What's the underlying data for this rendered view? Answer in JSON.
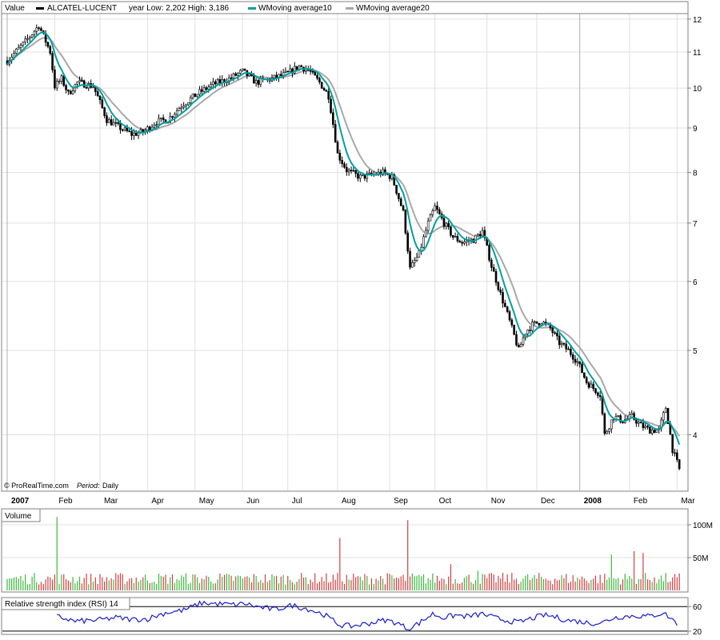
{
  "chart_data": [
    {
      "type": "candlestick",
      "title_label": "Value",
      "instrument": "ALCATEL-LUCENT",
      "year_range": "year Low: 2,202 High: 3,186",
      "legend": [
        {
          "name": "ALCATEL-LUCENT",
          "color": "#000000"
        },
        {
          "name": "WMoving average10",
          "color": "#00a0a0"
        },
        {
          "name": "WMoving average20",
          "color": "#a8a8a8"
        }
      ],
      "y_scale": "log",
      "ylim": [
        3.55,
        12.15
      ],
      "y_ticks": [
        4,
        5,
        6,
        7,
        8,
        9,
        10,
        11,
        12
      ],
      "x_ticks": [
        {
          "label": "2007",
          "bold": true,
          "day": 0
        },
        {
          "label": "Feb",
          "bold": false,
          "day": 21
        },
        {
          "label": "Mar",
          "bold": false,
          "day": 41
        },
        {
          "label": "Apr",
          "bold": false,
          "day": 62
        },
        {
          "label": "May",
          "bold": false,
          "day": 83
        },
        {
          "label": "Jun",
          "bold": false,
          "day": 104
        },
        {
          "label": "Jul",
          "bold": false,
          "day": 124
        },
        {
          "label": "Aug",
          "bold": false,
          "day": 146
        },
        {
          "label": "Sep",
          "bold": false,
          "day": 169
        },
        {
          "label": "Oct",
          "bold": false,
          "day": 189
        },
        {
          "label": "Nov",
          "bold": false,
          "day": 212
        },
        {
          "label": "Dec",
          "bold": false,
          "day": 234
        },
        {
          "label": "2008",
          "bold": true,
          "day": 253
        },
        {
          "label": "Feb",
          "bold": false,
          "day": 275
        },
        {
          "label": "Mar",
          "bold": false,
          "day": 296
        }
      ],
      "price_path": [
        [
          0,
          10.75
        ],
        [
          8,
          11.3
        ],
        [
          14,
          11.8
        ],
        [
          19,
          11.0
        ],
        [
          21,
          10.05
        ],
        [
          24,
          10.25
        ],
        [
          27,
          9.85
        ],
        [
          31,
          10.15
        ],
        [
          38,
          10.05
        ],
        [
          44,
          9.2
        ],
        [
          50,
          9.0
        ],
        [
          55,
          8.85
        ],
        [
          60,
          8.9
        ],
        [
          66,
          9.15
        ],
        [
          71,
          9.2
        ],
        [
          77,
          9.55
        ],
        [
          84,
          9.85
        ],
        [
          91,
          10.1
        ],
        [
          98,
          10.25
        ],
        [
          104,
          10.45
        ],
        [
          110,
          10.15
        ],
        [
          117,
          10.25
        ],
        [
          124,
          10.4
        ],
        [
          129,
          10.6
        ],
        [
          133,
          10.5
        ],
        [
          138,
          10.15
        ],
        [
          142,
          9.8
        ],
        [
          146,
          8.4
        ],
        [
          150,
          8.05
        ],
        [
          156,
          7.9
        ],
        [
          161,
          7.95
        ],
        [
          166,
          8.0
        ],
        [
          170,
          7.9
        ],
        [
          175,
          7.2
        ],
        [
          178,
          6.2
        ],
        [
          182,
          6.45
        ],
        [
          186,
          7.0
        ],
        [
          189,
          7.3
        ],
        [
          193,
          7.0
        ],
        [
          197,
          6.75
        ],
        [
          201,
          6.65
        ],
        [
          206,
          6.7
        ],
        [
          210,
          6.85
        ],
        [
          214,
          6.25
        ],
        [
          218,
          5.8
        ],
        [
          222,
          5.4
        ],
        [
          226,
          5.0
        ],
        [
          229,
          5.25
        ],
        [
          232,
          5.35
        ],
        [
          236,
          5.4
        ],
        [
          240,
          5.3
        ],
        [
          244,
          5.1
        ],
        [
          248,
          5.0
        ],
        [
          252,
          4.85
        ],
        [
          256,
          4.6
        ],
        [
          260,
          4.5
        ],
        [
          262,
          4.45
        ],
        [
          264,
          4.0
        ],
        [
          268,
          4.2
        ],
        [
          272,
          4.15
        ],
        [
          276,
          4.2
        ],
        [
          280,
          4.1
        ],
        [
          284,
          4.05
        ],
        [
          288,
          4.05
        ],
        [
          291,
          4.3
        ],
        [
          294,
          3.85
        ],
        [
          297,
          3.65
        ]
      ],
      "copyright": "© ProRealTime.com",
      "period_label": "Period:",
      "period_value": "Daily"
    },
    {
      "type": "bar",
      "title_label": "Volume",
      "y_ticks": [
        "50M",
        "100M"
      ],
      "y_tick_values": [
        50,
        100
      ],
      "ylim": [
        0,
        122
      ],
      "unit": "millions of shares",
      "spikes": [
        [
          22,
          112
        ],
        [
          147,
          80
        ],
        [
          177,
          107
        ],
        [
          196,
          40
        ],
        [
          208,
          30
        ],
        [
          267,
          55
        ],
        [
          277,
          60
        ],
        [
          281,
          57
        ],
        [
          286,
          20
        ],
        [
          294,
          20
        ]
      ],
      "baseline_volume": 20
    },
    {
      "type": "line",
      "title_label": "Relative strength index (RSI) 14",
      "y_ticks": [
        20,
        60
      ],
      "ylim": [
        16,
        72
      ],
      "color": "#1a1acc",
      "rsi_path": [
        [
          22,
          44
        ],
        [
          30,
          36
        ],
        [
          40,
          38
        ],
        [
          48,
          42
        ],
        [
          55,
          39
        ],
        [
          62,
          40
        ],
        [
          70,
          50
        ],
        [
          78,
          54
        ],
        [
          86,
          66
        ],
        [
          94,
          64
        ],
        [
          101,
          63
        ],
        [
          105,
          65
        ],
        [
          110,
          60
        ],
        [
          118,
          55
        ],
        [
          126,
          62
        ],
        [
          133,
          56
        ],
        [
          140,
          47
        ],
        [
          147,
          30
        ],
        [
          152,
          28
        ],
        [
          160,
          33
        ],
        [
          167,
          38
        ],
        [
          172,
          34
        ],
        [
          177,
          24
        ],
        [
          182,
          33
        ],
        [
          188,
          48
        ],
        [
          193,
          42
        ],
        [
          198,
          46
        ],
        [
          204,
          44
        ],
        [
          210,
          48
        ],
        [
          215,
          42
        ],
        [
          220,
          38
        ],
        [
          226,
          34
        ],
        [
          231,
          40
        ],
        [
          237,
          46
        ],
        [
          241,
          44
        ],
        [
          247,
          38
        ],
        [
          252,
          36
        ],
        [
          258,
          33
        ],
        [
          263,
          34
        ],
        [
          268,
          42
        ],
        [
          273,
          44
        ],
        [
          278,
          45
        ],
        [
          284,
          44
        ],
        [
          290,
          50
        ],
        [
          296,
          33
        ]
      ]
    }
  ]
}
